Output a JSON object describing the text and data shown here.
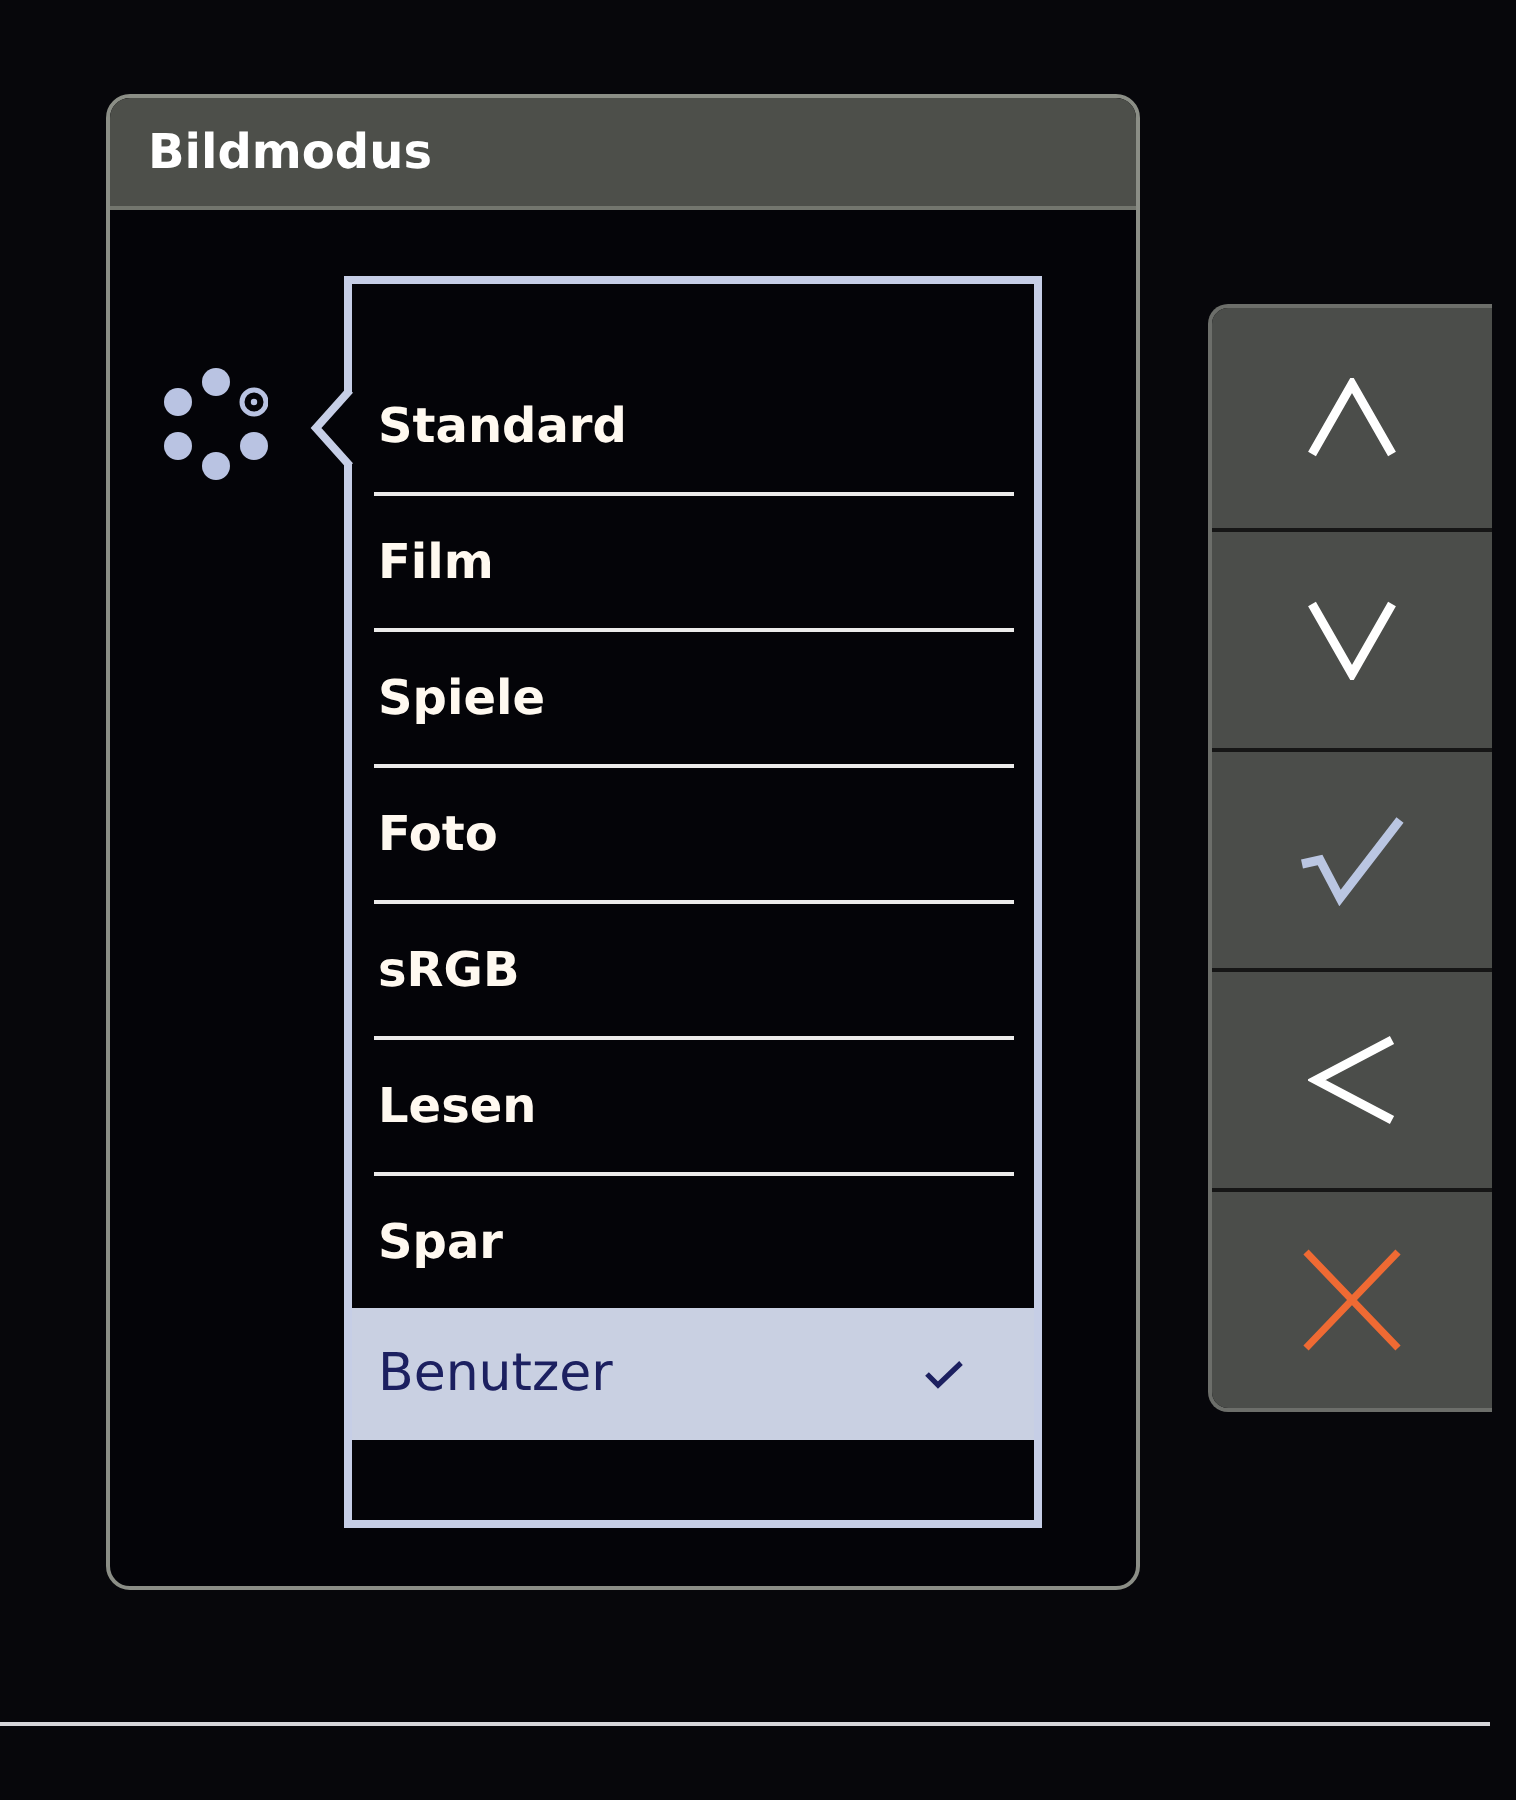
{
  "menu": {
    "title": "Bildmodus",
    "items": [
      {
        "label": "Standard",
        "selected": false,
        "checked": false
      },
      {
        "label": "Film",
        "selected": false,
        "checked": false
      },
      {
        "label": "Spiele",
        "selected": false,
        "checked": false
      },
      {
        "label": "Foto",
        "selected": false,
        "checked": false
      },
      {
        "label": "sRGB",
        "selected": false,
        "checked": false
      },
      {
        "label": "Lesen",
        "selected": false,
        "checked": false
      },
      {
        "label": "Spar",
        "selected": false,
        "checked": false
      },
      {
        "label": "Benutzer",
        "selected": true,
        "checked": true
      }
    ]
  },
  "buttons": [
    {
      "kind": "up"
    },
    {
      "kind": "down"
    },
    {
      "kind": "confirm"
    },
    {
      "kind": "back"
    },
    {
      "kind": "close"
    }
  ]
}
